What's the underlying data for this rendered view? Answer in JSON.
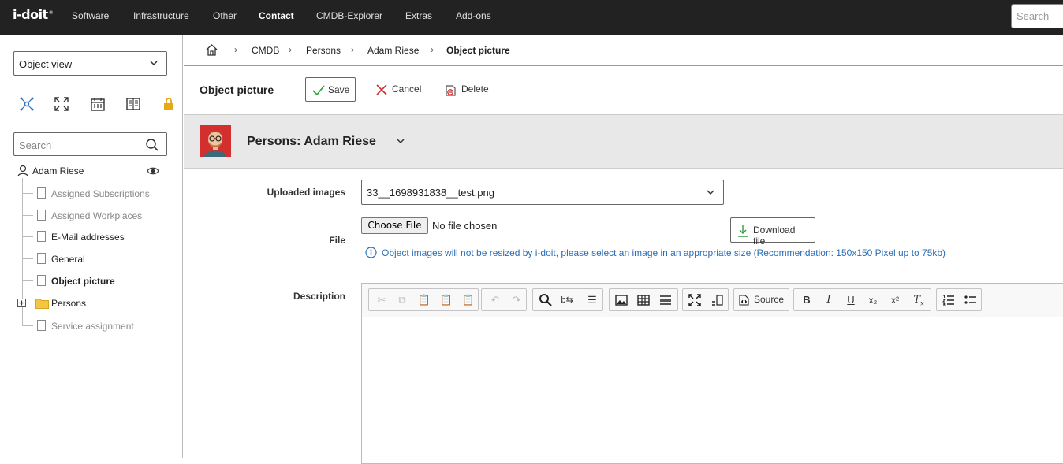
{
  "app": {
    "logo": "i-doit",
    "logo_mark": "®"
  },
  "nav": {
    "items": [
      "Software",
      "Infrastructure",
      "Other",
      "Contact",
      "CMDB-Explorer",
      "Extras",
      "Add-ons"
    ],
    "active": "Contact",
    "search_placeholder": "Search"
  },
  "sidebar": {
    "view_select": "Object view",
    "search_placeholder": "Search",
    "root": "Adam Riese",
    "items": [
      {
        "label": "Assigned Subscriptions",
        "state": "dim"
      },
      {
        "label": "Assigned Workplaces",
        "state": "dim"
      },
      {
        "label": "E-Mail addresses",
        "state": "normal"
      },
      {
        "label": "General",
        "state": "normal"
      },
      {
        "label": "Object picture",
        "state": "bold"
      },
      {
        "label": "Persons",
        "state": "folder"
      },
      {
        "label": "Service assignment",
        "state": "dim"
      }
    ]
  },
  "breadcrumb": [
    "CMDB",
    "Persons",
    "Adam Riese",
    "Object picture"
  ],
  "form": {
    "title": "Object picture",
    "save_label": "Save",
    "cancel_label": "Cancel",
    "delete_label": "Delete"
  },
  "object": {
    "title": "Persons: Adam Riese"
  },
  "fields": {
    "uploaded_images_label": "Uploaded images",
    "uploaded_images_value": "33__1698931838__test.png",
    "file_label": "File",
    "choose_file_label": "Choose File",
    "no_file_text": "No file chosen",
    "download_label": "Download file",
    "hint": "Object images will not be resized by i-doit, please select an image in an appropriate size (Recommendation: 150x150 Pixel up to 75kb)",
    "description_label": "Description"
  },
  "editor": {
    "source_label": "Source"
  },
  "colors": {
    "topbar": "#222222",
    "accent_blue": "#2a6eb8",
    "avatar_bg": "#d32f2f",
    "objbar": "#e8e8e8"
  }
}
